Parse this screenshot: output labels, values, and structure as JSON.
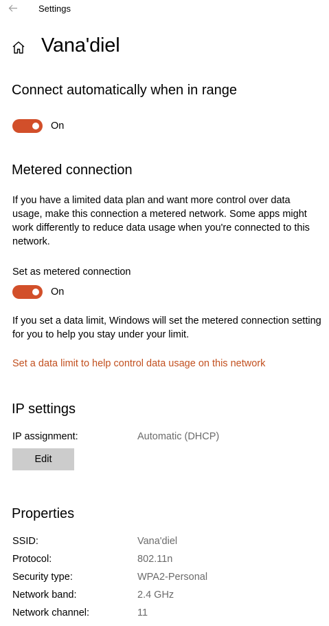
{
  "window": {
    "title": "Settings"
  },
  "header": {
    "title": "Vana'diel"
  },
  "connect_auto": {
    "heading": "Connect automatically when in range",
    "toggle_state": "On",
    "toggle_on": true
  },
  "metered": {
    "heading": "Metered connection",
    "description": "If you have a limited data plan and want more control over data usage, make this connection a metered network. Some apps might work differently to reduce data usage when you're connected to this network.",
    "set_label": "Set as metered connection",
    "toggle_state": "On",
    "toggle_on": true,
    "limit_note": "If you set a data limit, Windows will set the metered connection setting for you to help you stay under your limit.",
    "limit_link": "Set a data limit to help control data usage on this network"
  },
  "ip_settings": {
    "heading": "IP settings",
    "assignment_label": "IP assignment:",
    "assignment_value": "Automatic (DHCP)",
    "edit_label": "Edit"
  },
  "properties": {
    "heading": "Properties",
    "rows": [
      {
        "label": "SSID:",
        "value": "Vana'diel"
      },
      {
        "label": "Protocol:",
        "value": "802.11n"
      },
      {
        "label": "Security type:",
        "value": "WPA2-Personal"
      },
      {
        "label": "Network band:",
        "value": "2.4 GHz"
      },
      {
        "label": "Network channel:",
        "value": "11"
      }
    ]
  },
  "colors": {
    "accent": "#d24f2a",
    "link": "#c2501f",
    "value_text": "#6b6b6b",
    "button_bg": "#cccccc"
  },
  "icons": {
    "back": "back-arrow-icon",
    "home": "home-icon"
  }
}
